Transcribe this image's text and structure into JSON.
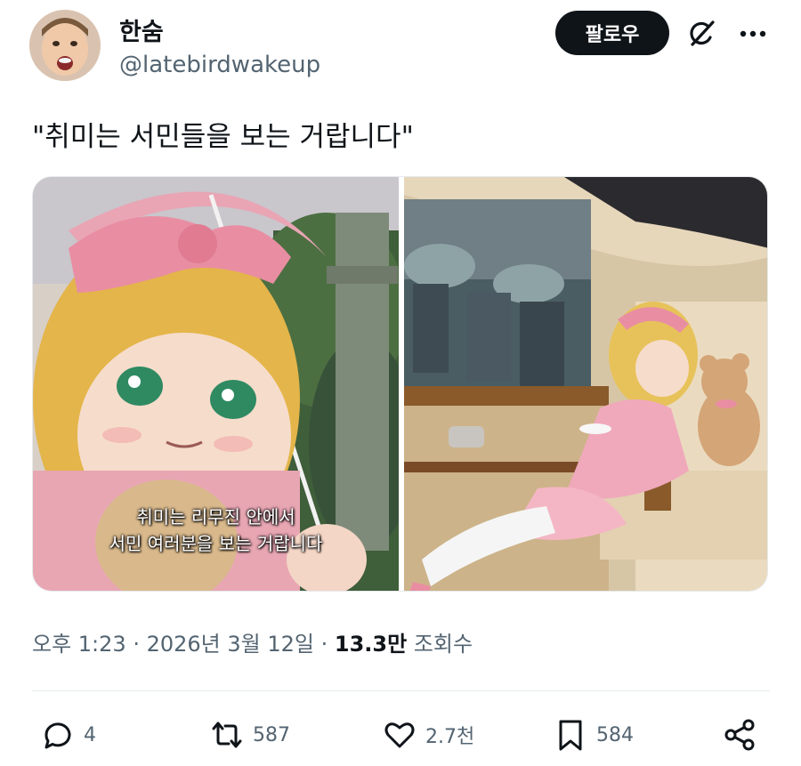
{
  "author": {
    "display_name": "한숨",
    "handle": "@latebirdwakeup"
  },
  "follow_label": "팔로우",
  "tweet_text": "\"취미는 서민들을 보는 거랍니다\"",
  "media": {
    "subtitle_line1": "취미는 리무진 안에서",
    "subtitle_line2": "서민 여러분을 보는 거랍니다"
  },
  "meta": {
    "time": "오후 1:23",
    "date": "2026년 3월 12일",
    "views_count": "13.3만",
    "views_label": "조회수"
  },
  "actions": {
    "replies": "4",
    "reposts": "587",
    "likes": "2.7천",
    "bookmarks": "584"
  },
  "icons": [
    "avatar",
    "grok-icon",
    "more-icon",
    "reply-icon",
    "repost-icon",
    "like-icon",
    "bookmark-icon",
    "share-icon"
  ]
}
